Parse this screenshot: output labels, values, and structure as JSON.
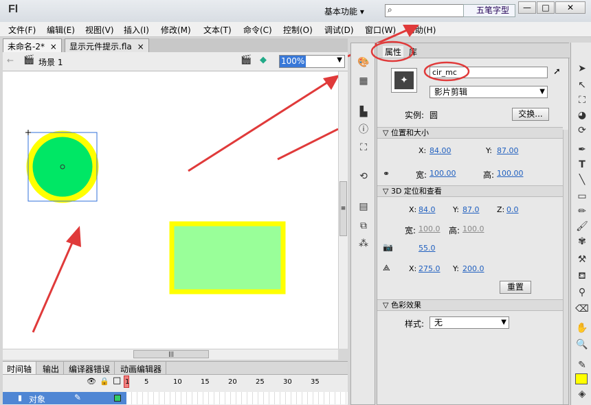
{
  "app": {
    "logo": "Fl",
    "workspace": "基本功能 ▾",
    "search_suggestion": "五笔字型"
  },
  "window_buttons": [
    "—",
    "□",
    "✕"
  ],
  "menu": [
    "文件(F)",
    "编辑(E)",
    "视图(V)",
    "插入(I)",
    "修改(M)",
    "文本(T)",
    "命令(C)",
    "控制(O)",
    "调试(D)",
    "窗口(W)",
    "帮助(H)"
  ],
  "doc_tabs": [
    {
      "label": "未命名-2*",
      "close": "×"
    },
    {
      "label": "显示元件提示.fla",
      "close": "×"
    }
  ],
  "scene": {
    "label": "场景 1",
    "zoom": "100%"
  },
  "hscroll_grip": "|||",
  "vscroll_grip": "≡",
  "timeline": {
    "tabs": [
      "时间轴",
      "输出",
      "编译器错误",
      "动画编辑器"
    ],
    "frame_numbers": [
      "1",
      "5",
      "10",
      "15",
      "20",
      "25",
      "30",
      "35"
    ],
    "layer_name": "对象",
    "visibility_icons": [
      "👁",
      "🔒",
      "□"
    ]
  },
  "properties": {
    "tabs": [
      "属性",
      "库"
    ],
    "instance_name": "cir_mc",
    "symbol_type": "影片剪辑",
    "instance_label": "实例:",
    "instance_of": "圆",
    "swap_button": "交换...",
    "position_size": {
      "header": "位置和大小",
      "x_label": "X:",
      "x": "84.00",
      "y_label": "Y:",
      "y": "87.00",
      "w_label": "宽:",
      "w": "100.00",
      "h_label": "高:",
      "h": "100.00"
    },
    "three_d": {
      "header": "3D 定位和查看",
      "x_label": "X:",
      "x": "84.0",
      "y_label": "Y:",
      "y": "87.0",
      "z_label": "Z:",
      "z": "0.0",
      "w_label": "宽:",
      "w": "100.0",
      "h_label": "高:",
      "h": "100.0",
      "perspective": "55.0",
      "vx_label": "X:",
      "vx": "275.0",
      "vy_label": "Y:",
      "vy": "200.0",
      "reset_button": "重置"
    },
    "color_effect": {
      "header": "色彩效果",
      "style_label": "样式:",
      "style_value": "无"
    }
  },
  "colors": {
    "circle_fill": "#00e765",
    "circle_stroke": "#ffff00",
    "rect_fill": "#99ff99",
    "rect_stroke": "#ffff00",
    "annotation": "#e03a3a"
  }
}
